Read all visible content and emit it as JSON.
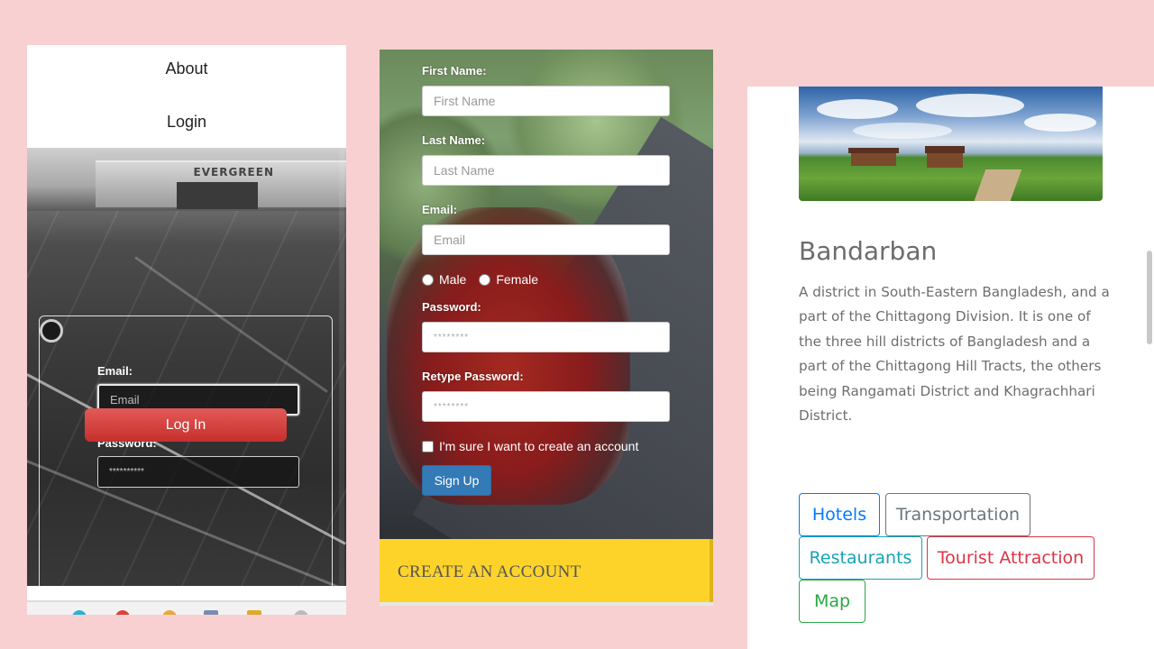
{
  "login_screen": {
    "nav": {
      "about": "About",
      "login": "Login"
    },
    "hangar_sign": "EVERGREEN",
    "email_label": "Email:",
    "email_placeholder": "Email",
    "password_label": "Password:",
    "password_value": "**********",
    "login_button": "Log In"
  },
  "signup_form": {
    "first_name_label": "First Name:",
    "first_name_placeholder": "First Name",
    "last_name_label": "Last Name:",
    "last_name_placeholder": "Last Name",
    "email_label": "Email:",
    "email_placeholder": "Email",
    "gender_options": [
      "Male",
      "Female"
    ],
    "password_label": "Password:",
    "password_value": "********",
    "retype_password_label": "Retype Password:",
    "retype_password_value": "********",
    "confirm_checkbox_label": "I'm sure I want to create an account",
    "signup_button": "Sign Up",
    "footer_title": "CREATE AN ACCOUNT"
  },
  "destination": {
    "title": "Bandarban",
    "description": "A district in South-Eastern Bangladesh, and a part of the Chittagong Division. It is one of the three hill districts of Bangladesh and a part of the Chittagong Hill Tracts, the others being Rangamati District and Khagrachhari District.",
    "tags": [
      {
        "label": "Hotels",
        "color": "#007bff"
      },
      {
        "label": "Transportation",
        "color": "#6c757d"
      },
      {
        "label": "Restaurants",
        "color": "#17a2b8"
      },
      {
        "label": "Tourist Attraction",
        "color": "#dc3545"
      },
      {
        "label": "Map",
        "color": "#28a745"
      }
    ]
  },
  "colors": {
    "background": "#f8d0d1",
    "login_button": "#c62f2c",
    "signup_button": "#337ab7",
    "footer_yellow": "#fdd32a"
  }
}
